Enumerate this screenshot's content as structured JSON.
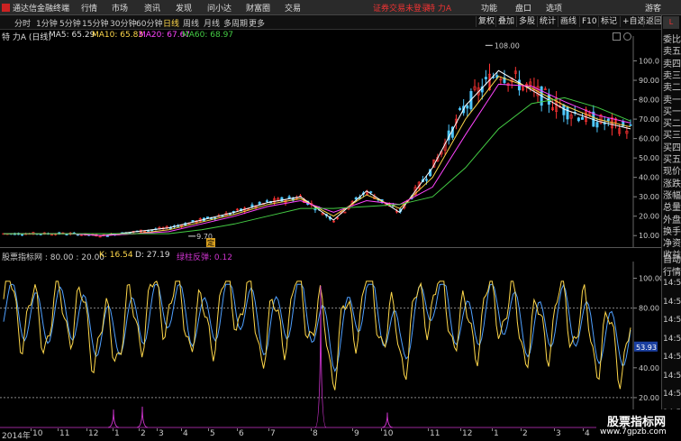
{
  "menubar": {
    "app_name": "通达信金融终端",
    "menus": [
      "行情",
      "市场",
      "资讯",
      "发现",
      "问小达",
      "财富圈",
      "交易"
    ],
    "status": "证券交易未登录",
    "stock": "特 力A",
    "right_menus": [
      "功能",
      "盘口",
      "选项",
      "游客"
    ]
  },
  "toolbar": {
    "periods": [
      "分时",
      "1分钟",
      "5分钟",
      "15分钟",
      "30分钟",
      "60分钟",
      "日线",
      "周线",
      "月线",
      "多周期",
      "更多"
    ],
    "active_period": "日线",
    "tools": [
      "复权",
      "叠加",
      "多股",
      "统计",
      "画线",
      "F10",
      "标记",
      "+自选",
      "返回"
    ]
  },
  "main_chart": {
    "stock_label": "特 力A (日线)",
    "ma5": "MA5: 65.29",
    "ma10": "MA10: 65.83",
    "ma20": "MA20: 67.67",
    "ma60": "MA60: 68.97",
    "high_marker": "108.00",
    "low_marker": "9.70",
    "event_marker": "定",
    "y_ticks": [
      "100.0",
      "90.00",
      "80.00",
      "70.00",
      "60.00",
      "50.00",
      "40.00",
      "30.00",
      "20.00",
      "10.00"
    ]
  },
  "indicator": {
    "name": "股票指标网 : 80.00 : 20.00",
    "k": "K: 16.54",
    "d": "D: 27.19",
    "extra": "绿柱反弹: 0.12",
    "y_ticks": [
      "100.00",
      "80.00",
      "40.00",
      "20.00"
    ],
    "current_value": "53.93"
  },
  "x_axis": {
    "labels": [
      "2014年",
      "10",
      "11",
      "12",
      "1",
      "2",
      "3",
      "4",
      "5",
      "6",
      "7",
      "8",
      "9",
      "10",
      "11",
      "12",
      "1",
      "2",
      "3",
      "4"
    ]
  },
  "right_panel": {
    "badge": "L",
    "labels": [
      "委比",
      "卖五",
      "卖四",
      "卖三",
      "卖二",
      "卖一",
      "买一",
      "买二",
      "买三",
      "买四",
      "买五",
      "现价",
      "涨跌",
      "涨幅",
      "总量",
      "外盘",
      "换手",
      "净资",
      "收益",
      "自动",
      "行情",
      "14:50",
      "14:50",
      "14:50",
      "14:50",
      "14:50",
      "14:50",
      "14:50",
      "14:50",
      "14:50"
    ]
  },
  "watermark": {
    "line1": "股票指标网",
    "line2": "www.7gpzb.com"
  },
  "colors": {
    "up": "#ff3333",
    "down": "#4fc8ff",
    "ma5": "#ffffff",
    "ma10": "#ffd84a",
    "ma20": "#ff44ff",
    "ma60": "#44cc44",
    "k_line": "#ffd84a",
    "d_line": "#4fa0ff",
    "spike": "#cc33cc"
  },
  "chart_data": [
    {
      "type": "line",
      "title": "特 力A (日线)",
      "x": [
        "2014-09",
        "2014-10",
        "2014-11",
        "2014-12",
        "2015-01",
        "2015-02",
        "2015-03",
        "2015-04",
        "2015-05",
        "2015-06",
        "2015-07",
        "2015-08",
        "2015-09",
        "2015-10",
        "2015-11",
        "2015-12",
        "2016-01",
        "2016-02",
        "2016-03",
        "2016-04"
      ],
      "series": [
        {
          "name": "MA5",
          "values": [
            11,
            11,
            11,
            10,
            12,
            14,
            18,
            22,
            27,
            30,
            18,
            33,
            22,
            45,
            77,
            95,
            85,
            75,
            69,
            65
          ]
        },
        {
          "name": "MA10",
          "values": [
            11,
            11,
            11,
            10,
            11,
            13,
            17,
            21,
            26,
            29,
            20,
            31,
            24,
            40,
            70,
            92,
            86,
            77,
            70,
            66
          ]
        },
        {
          "name": "MA20",
          "values": [
            11,
            11,
            11,
            10,
            11,
            12,
            16,
            20,
            25,
            28,
            22,
            28,
            26,
            35,
            62,
            88,
            87,
            79,
            72,
            68
          ]
        },
        {
          "name": "MA60",
          "values": [
            11,
            11,
            11,
            11,
            11,
            11,
            13,
            16,
            20,
            24,
            24,
            25,
            26,
            30,
            45,
            65,
            78,
            81,
            76,
            69
          ]
        }
      ],
      "ylim": [
        5,
        110
      ]
    },
    {
      "type": "line",
      "title": "股票指标网",
      "x": [
        "2014-09",
        "2014-10",
        "2014-11",
        "2014-12",
        "2015-01",
        "2015-02",
        "2015-03",
        "2015-04",
        "2015-05",
        "2015-06",
        "2015-07",
        "2015-08",
        "2015-09",
        "2015-10",
        "2015-11",
        "2015-12",
        "2016-01",
        "2016-02",
        "2016-03",
        "2016-04"
      ],
      "series": [
        {
          "name": "K",
          "values": [
            82,
            50,
            70,
            25,
            55,
            85,
            40,
            90,
            30,
            88,
            10,
            95,
            15,
            96,
            35,
            80,
            30,
            70,
            25,
            17
          ]
        },
        {
          "name": "D",
          "values": [
            75,
            55,
            65,
            35,
            50,
            80,
            45,
            85,
            38,
            82,
            18,
            90,
            22,
            92,
            42,
            76,
            36,
            66,
            32,
            27
          ]
        }
      ],
      "ylim": [
        0,
        110
      ]
    }
  ]
}
